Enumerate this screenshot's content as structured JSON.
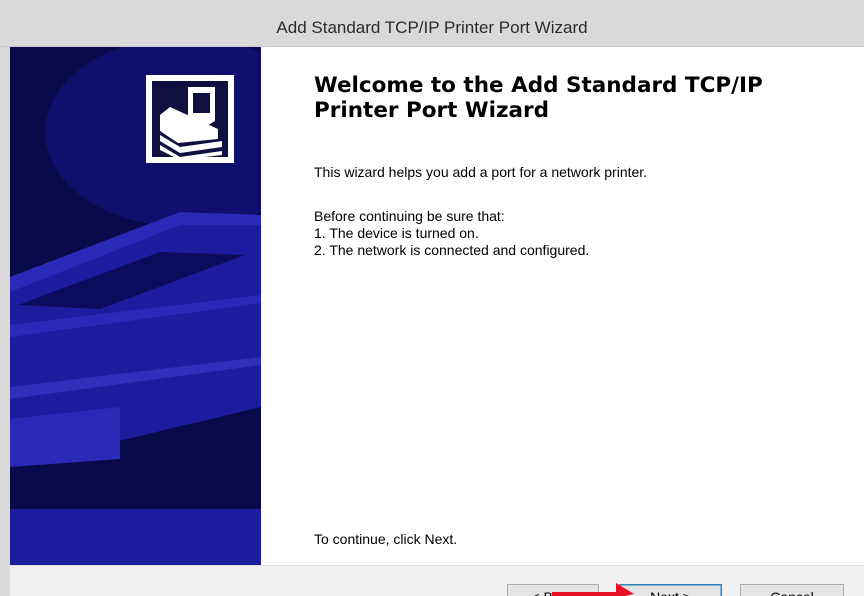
{
  "window": {
    "title": "Add Standard TCP/IP Printer Port Wizard"
  },
  "banner": {
    "icon": "printer-network-icon",
    "colors": {
      "dark": "#0a0a4a",
      "mid": "#1c1c9e",
      "light": "#2a2ab8"
    }
  },
  "main": {
    "heading": "Welcome to the Add Standard TCP/IP Printer Port Wizard",
    "intro": "This wizard helps you add a port for a network printer.",
    "before_label": "Before continuing be sure that:",
    "conditions": [
      "1. The device is turned on.",
      "2. The network is connected and configured."
    ],
    "continue_text": "To continue, click Next."
  },
  "footer": {
    "back_label": "< Back",
    "next_label": "Next >",
    "cancel_label": "Cancel"
  },
  "annotation": {
    "color": "#e81123",
    "target": "next-button"
  }
}
